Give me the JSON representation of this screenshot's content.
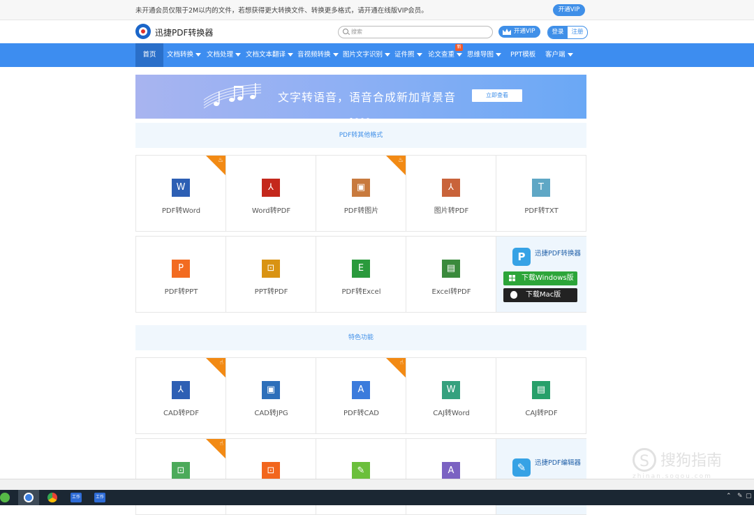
{
  "topbar": {
    "notice": "未开通会员仅限于2M以内的文件，若想获得更大转换文件、转换更多格式，请开通在线版VIP会员。",
    "vip_button": "开通VIP"
  },
  "header": {
    "logo_text": "迅捷PDF转换器",
    "search_placeholder": "搜索",
    "vip_button": "开通VIP",
    "login": "登录",
    "register": "注册"
  },
  "nav": {
    "items": [
      {
        "label": "首页",
        "dropdown": false
      },
      {
        "label": "文档转换",
        "dropdown": true
      },
      {
        "label": "文档处理",
        "dropdown": true
      },
      {
        "label": "文档文本翻译",
        "dropdown": true
      },
      {
        "label": "音视频转换",
        "dropdown": true
      },
      {
        "label": "图片文字识别",
        "dropdown": true
      },
      {
        "label": "证件照",
        "dropdown": true
      },
      {
        "label": "论文查重",
        "dropdown": true
      },
      {
        "label": "思维导图",
        "dropdown": true
      },
      {
        "label": "PPT模板",
        "dropdown": false
      },
      {
        "label": "客户端",
        "dropdown": true
      }
    ],
    "new_badge": "新"
  },
  "banner": {
    "title": "文字转语音，语音合成新加背景音",
    "button": "立即查看"
  },
  "section1": {
    "title": "PDF转其他格式",
    "row1": [
      {
        "label": "PDF转Word",
        "glyph": "W",
        "color": "#2d5fb4",
        "hot": true
      },
      {
        "label": "Word转PDF",
        "glyph": "⅄",
        "color": "#c4281c",
        "hot": false
      },
      {
        "label": "PDF转图片",
        "glyph": "▣",
        "color": "#c87a3e",
        "hot": true
      },
      {
        "label": "图片转PDF",
        "glyph": "⅄",
        "color": "#c9633a",
        "hot": false
      },
      {
        "label": "PDF转TXT",
        "glyph": "T",
        "color": "#5fa7c5",
        "hot": false
      }
    ],
    "row2": [
      {
        "label": "PDF转PPT",
        "glyph": "P",
        "color": "#f26b21"
      },
      {
        "label": "PPT转PDF",
        "glyph": "⊡",
        "color": "#d99313"
      },
      {
        "label": "PDF转Excel",
        "glyph": "E",
        "color": "#2a9a3c"
      },
      {
        "label": "Excel转PDF",
        "glyph": "▤",
        "color": "#3a8a3c"
      }
    ],
    "promo": {
      "app_name": "迅捷PDF转换器",
      "windows": "下载Windows版",
      "mac": "下载Mac版"
    }
  },
  "section2": {
    "title": "特色功能",
    "row1": [
      {
        "label": "CAD转PDF",
        "glyph": "⅄",
        "color": "#2d5fb4",
        "hot": true
      },
      {
        "label": "CAD转JPG",
        "glyph": "▣",
        "color": "#2d6fba",
        "hot": false
      },
      {
        "label": "PDF转CAD",
        "glyph": "A",
        "color": "#3b7bdc",
        "hot": true
      },
      {
        "label": "CAJ转Word",
        "glyph": "W",
        "color": "#35a17e",
        "hot": false
      },
      {
        "label": "CAJ转PDF",
        "glyph": "▤",
        "color": "#27a06a",
        "hot": false
      }
    ],
    "row2": [
      {
        "glyph": "⊡",
        "color": "#4caa5a",
        "hot": true
      },
      {
        "glyph": "⊡",
        "color": "#f2661d"
      },
      {
        "glyph": "✎",
        "color": "#6bbf3c"
      },
      {
        "glyph": "A",
        "color": "#7b62c2"
      }
    ],
    "promo": {
      "app_name": "迅捷PDF编辑器"
    }
  },
  "watermark": {
    "text": "搜狗指南",
    "url": "zhinan.sogou.com"
  },
  "taskbar": {
    "labels": [
      "工作",
      "工作"
    ]
  }
}
